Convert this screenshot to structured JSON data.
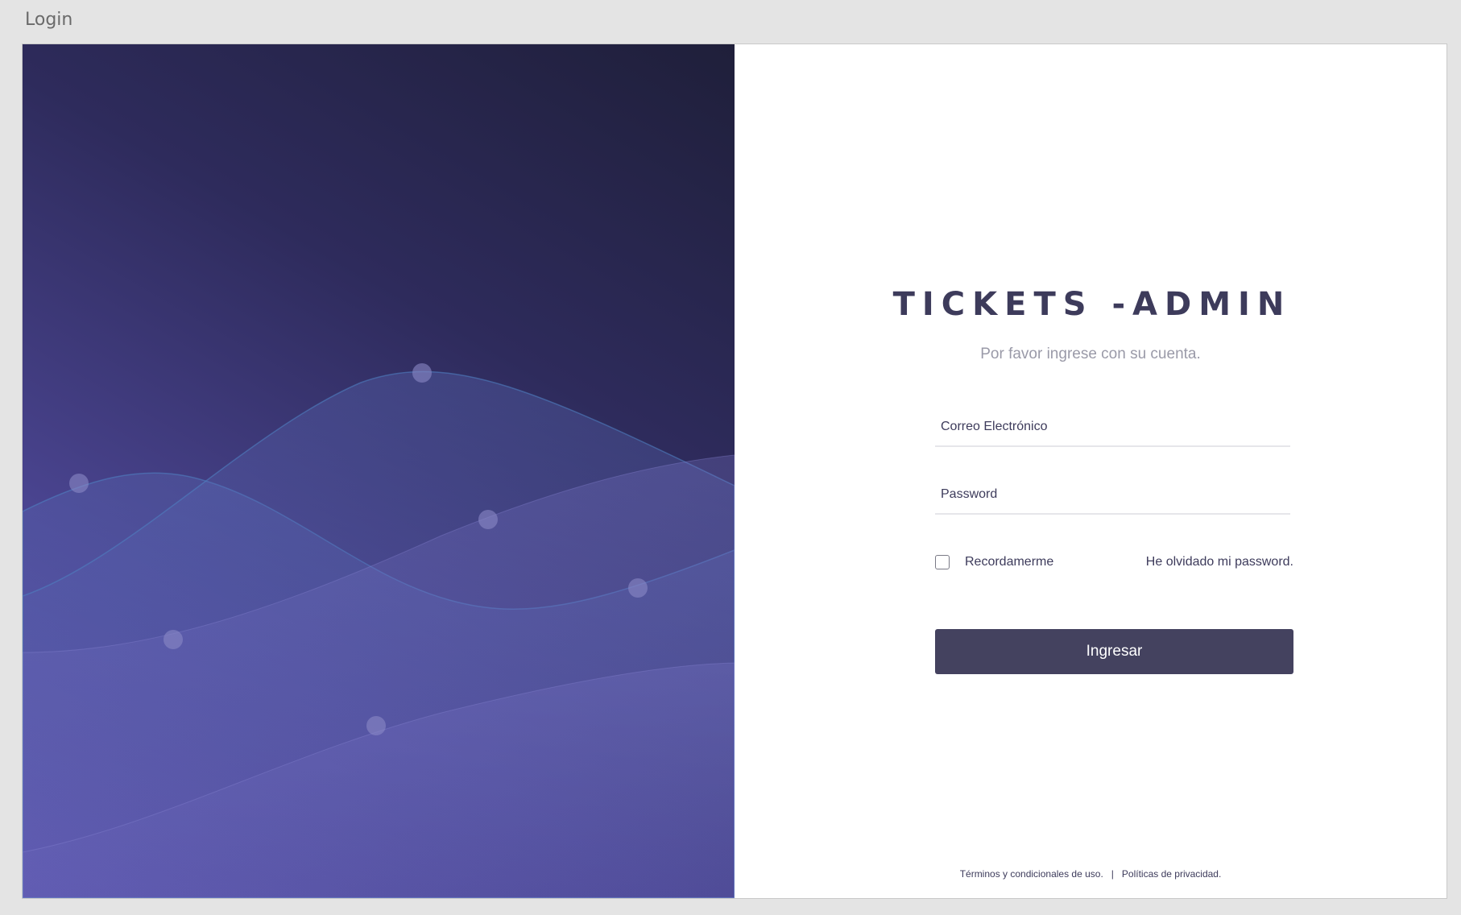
{
  "window": {
    "title": "Login"
  },
  "login": {
    "brand_title": "TICKETS -ADMIN",
    "subtitle": "Por favor ingrese con su cuenta.",
    "email_placeholder": "Correo Electrónico",
    "password_placeholder": "Password",
    "remember_label": "Recordamerme",
    "remember_checked": false,
    "forgot_label": "He olvidado mi password.",
    "submit_label": "Ingresar"
  },
  "footer": {
    "terms_label": "Términos y condicionales de uso.",
    "separator": "|",
    "privacy_label": "Políticas de privacidad."
  },
  "theme": {
    "primary": "#44425f",
    "text": "#3d3b5b",
    "muted": "#9a9aa8",
    "gradient_dark": "#1f1f3a",
    "gradient_light": "#5f58b0"
  }
}
